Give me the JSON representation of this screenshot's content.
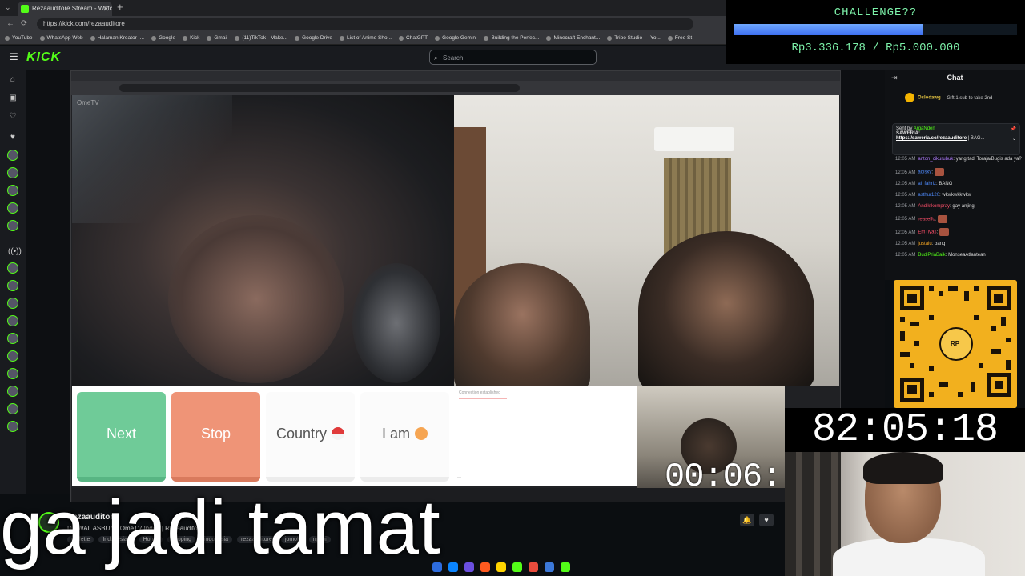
{
  "browser": {
    "tab_title": "Rezaauditore Stream - Watch",
    "url": "https://kick.com/rezaauditore",
    "bookmarks": [
      "YouTube",
      "WhatsApp Web",
      "Halaman Kreator -...",
      "Google",
      "Kick",
      "Gmail",
      "(11)TikTok - Make...",
      "Google Drive",
      "List of Anime Sho...",
      "ChatGPT",
      "Google Gemini",
      "Building the Perfec...",
      "Minecraft Enchant...",
      "Tripo Studio — Yo...",
      "Free St"
    ]
  },
  "kick": {
    "logo": "KICK",
    "search_placeholder": "Search"
  },
  "stream": {
    "omegle_logo": "OmeTV",
    "buttons": {
      "next": "Next",
      "stop": "Stop",
      "country": "Country",
      "iam": "I am"
    },
    "connection_msg": "Connection established",
    "self_timer": "00:06:",
    "caption": "ga jadi tamat",
    "channel_name": "Rezaauditore",
    "stream_title": "DIAWAL ASBUN? OmeTV Indo!! | Rezaauditore",
    "tags": [
      "roulette",
      "Indonesian",
      "Horror",
      "yapping",
      "indonesia",
      "rezaauditore",
      "jomok",
      "ngopi"
    ]
  },
  "chat": {
    "title": "Chat",
    "gift_user": "Oslodawg",
    "gift_text": "Gift 1 sub to take 2nd",
    "pinned_label": "Sent by",
    "pinned_sender": "ArgaNden",
    "pinned_head": "SAWERIA:",
    "pinned_link": "https://saweria.co/rezaauditore",
    "pinned_link_suffix": "| BAG...",
    "messages": [
      {
        "time": "12:05 AM",
        "user": "anton_cikurubuk",
        "color": "#b07cff",
        "text": "yang tadi Toraja/Bugis ada ya?"
      },
      {
        "time": "12:05 AM",
        "user": "aglsky",
        "color": "#4f8cff",
        "text": "",
        "emote": true
      },
      {
        "time": "12:05 AM",
        "user": "al_fahriz",
        "color": "#4f8cff",
        "text": "BANG"
      },
      {
        "time": "12:05 AM",
        "user": "asthur120",
        "color": "#4f8cff",
        "text": "wkwkwkkwkw"
      },
      {
        "time": "12:05 AM",
        "user": "Andiktkompray",
        "color": "#ff4f6a",
        "text": "gay anjing"
      },
      {
        "time": "12:05 AM",
        "user": "reaselfc",
        "color": "#ff4f6a",
        "text": "",
        "emote": true
      },
      {
        "time": "12:05 AM",
        "user": "EmTiyas",
        "color": "#ff4f6a",
        "text": "",
        "emote": true
      },
      {
        "time": "12:05 AM",
        "user": "justalu",
        "color": "#f5a623",
        "text": "bang"
      },
      {
        "time": "12:05 AM",
        "user": "BudiPriaBaik",
        "color": "#53fc18",
        "text": "MonseaAtlantean"
      }
    ]
  },
  "overlay": {
    "challenge_title": "CHALLENGE??",
    "progress_text": "Rp3.336.178 / Rp5.000.000",
    "progress_fraction": 0.667,
    "big_timer": "82:05:18",
    "qr_label": "RP"
  }
}
